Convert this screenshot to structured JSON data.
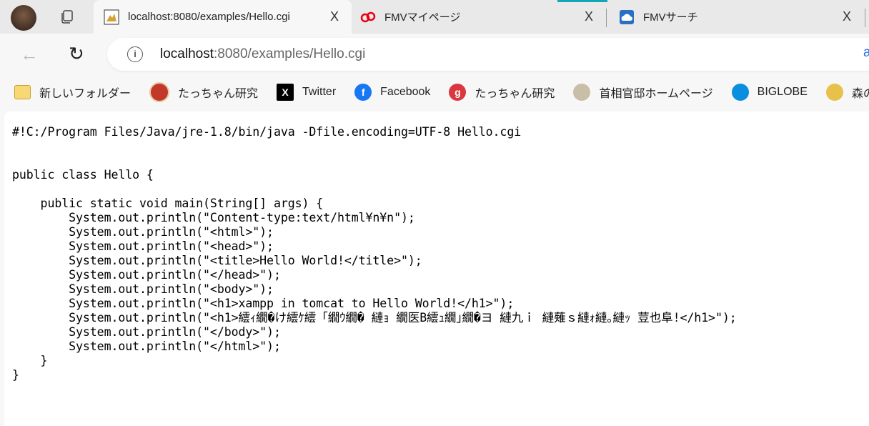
{
  "tabs": [
    {
      "title": "localhost:8080/examples/Hello.cgi",
      "active": true,
      "icon": "tomcat-icon"
    },
    {
      "title": "FMVマイページ",
      "active": false,
      "icon": "fmv-logo-icon"
    },
    {
      "title": "FMVサーチ",
      "active": false,
      "icon": "fmv-search-icon"
    }
  ],
  "tab_close_label": "X",
  "address": {
    "host": "localhost",
    "rest": ":8080/examples/Hello.cgi",
    "trailing": "a"
  },
  "bookmarks": [
    {
      "label": "新しいフォルダー",
      "icon": "folder-icon"
    },
    {
      "label": "たっちゃん研究",
      "icon": "avatar-icon"
    },
    {
      "label": "Twitter",
      "icon": "x-icon"
    },
    {
      "label": "Facebook",
      "icon": "facebook-icon"
    },
    {
      "label": "たっちゃん研究",
      "icon": "goo-icon"
    },
    {
      "label": "首相官邸ホームページ",
      "icon": "kantei-icon"
    },
    {
      "label": "BIGLOBE",
      "icon": "biglobe-icon"
    },
    {
      "label": "森の街タ",
      "icon": "character-icon"
    }
  ],
  "source_lines": [
    "#!C:/Program Files/Java/jre-1.8/bin/java -Dfile.encoding=UTF-8 Hello.cgi",
    "",
    "",
    "public class Hello {",
    "",
    "    public static void main(String[] args) {",
    "        System.out.println(\"Content-type:text/html¥n¥n\");",
    "        System.out.println(\"<html>\");",
    "        System.out.println(\"<head>\");",
    "        System.out.println(\"<title>Hello World!</title>\");",
    "        System.out.println(\"</head>\");",
    "        System.out.println(\"<body>\");",
    "        System.out.println(\"<h1>xampp in tomcat to Hello World!</h1>\");",
    "        System.out.println(\"<h1>繧ｨ繝�け繧ｹ繧「繝ｳ繝� 縺ｮ 繝医Β繧ｭ繝｣繝�ヨ 縺九ｉ 縺薙ｓ縺ｫ縺｡縺ｯ 荳也阜!</h1>\");",
    "        System.out.println(\"</body>\");",
    "        System.out.println(\"</html>\");",
    "    }",
    "}"
  ]
}
